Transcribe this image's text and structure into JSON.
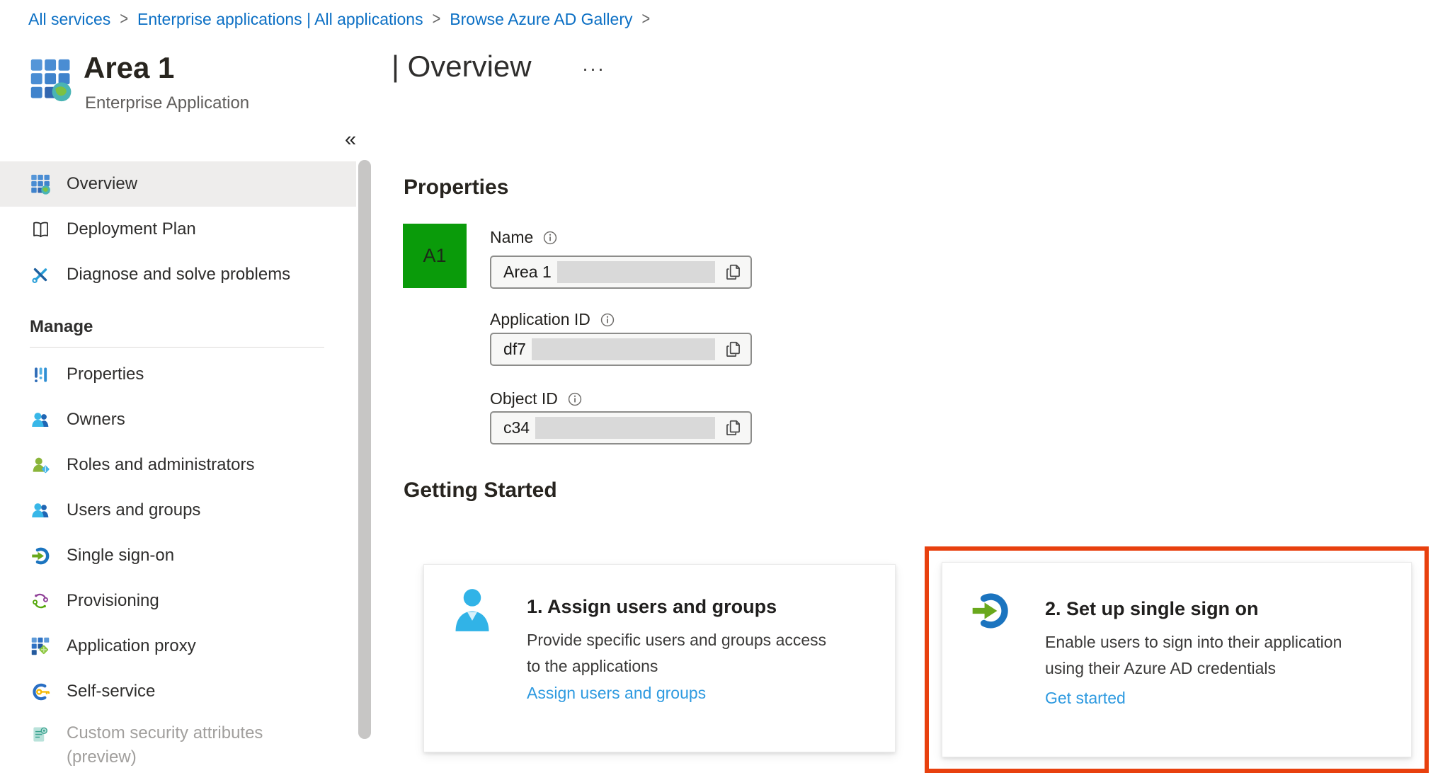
{
  "breadcrumb": {
    "separator": ">",
    "items": [
      {
        "label": "All services"
      },
      {
        "label": "Enterprise applications | All applications"
      },
      {
        "label": "Browse Azure AD Gallery"
      }
    ]
  },
  "header": {
    "app_name": "Area 1",
    "app_type": "Enterprise Application",
    "page_title": "| Overview",
    "more_icon": "···",
    "collapse_icon": "«"
  },
  "sidebar": {
    "items": [
      {
        "label": "Overview"
      },
      {
        "label": "Deployment Plan"
      },
      {
        "label": "Diagnose and solve problems"
      }
    ],
    "section_label": "Manage",
    "manage_items": [
      {
        "label": "Properties"
      },
      {
        "label": "Owners"
      },
      {
        "label": "Roles and administrators"
      },
      {
        "label": "Users and groups"
      },
      {
        "label": "Single sign-on"
      },
      {
        "label": "Provisioning"
      },
      {
        "label": "Application proxy"
      },
      {
        "label": "Self-service"
      },
      {
        "label": "Custom security attributes",
        "label2": "(preview)"
      }
    ]
  },
  "properties": {
    "heading": "Properties",
    "tile_label": "A1",
    "tile_color": "#0a9b0a",
    "fields": [
      {
        "label": "Name",
        "value": "Area 1"
      },
      {
        "label": "Application ID",
        "value": "df7"
      },
      {
        "label": "Object ID",
        "value": "c34"
      }
    ]
  },
  "getting_started": {
    "heading": "Getting Started",
    "cards": [
      {
        "title": "1. Assign users and groups",
        "desc_lines": [
          "Provide specific users and groups access",
          "to the applications"
        ],
        "link": "Assign users and groups",
        "highlighted": false
      },
      {
        "title": "2. Set up single sign on",
        "desc_lines": [
          "Enable users to sign into their application",
          "using their Azure AD credentials"
        ],
        "link": "Get started",
        "highlighted": true
      }
    ]
  },
  "colors": {
    "breadcrumb_link": "#0b6fc4",
    "card_link": "#2e9ae0",
    "highlight_border": "#e8400e",
    "tile_green": "#0a9b0a",
    "selected_row_bg": "#eeedec"
  }
}
